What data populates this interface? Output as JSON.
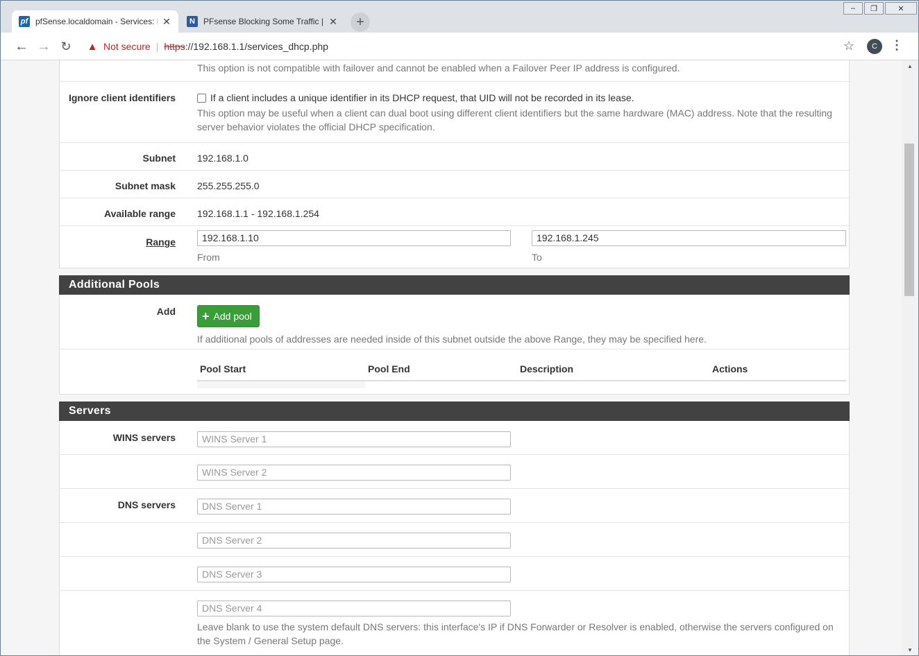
{
  "browser": {
    "tabs": [
      {
        "title": "pfSense.localdomain - Services: D",
        "active": true
      },
      {
        "title": "PFsense Blocking Some Traffic | N",
        "active": false
      }
    ],
    "new_tab": "+",
    "address": {
      "warning": "Not secure",
      "scheme": "https",
      "rest": "://192.168.1.1/services_dhcp.php"
    },
    "profile_initial": "C",
    "window_controls": {
      "minimize": "–",
      "restore": "❐",
      "close": "✕"
    }
  },
  "dhcp": {
    "failover_note": "This option is not compatible with failover and cannot be enabled when a Failover Peer IP address is configured.",
    "ignore_client": {
      "label": "Ignore client identifiers",
      "checkbox_text": "If a client includes a unique identifier in its DHCP request, that UID will not be recorded in its lease.",
      "help": "This option may be useful when a client can dual boot using different client identifiers but the same hardware (MAC) address. Note that the resulting server behavior violates the official DHCP specification."
    },
    "subnet": {
      "label": "Subnet",
      "value": "192.168.1.0"
    },
    "subnet_mask": {
      "label": "Subnet mask",
      "value": "255.255.255.0"
    },
    "available_range": {
      "label": "Available range",
      "value": "192.168.1.1 - 192.168.1.254"
    },
    "range": {
      "label": "Range",
      "from_value": "192.168.1.10",
      "from_label": "From",
      "to_value": "192.168.1.245",
      "to_label": "To"
    }
  },
  "additional_pools": {
    "header": "Additional Pools",
    "add_label": "Add",
    "add_button": "Add pool",
    "help": "If additional pools of addresses are needed inside of this subnet outside the above Range, they may be specified here.",
    "columns": [
      "Pool Start",
      "Pool End",
      "Description",
      "Actions"
    ]
  },
  "servers": {
    "header": "Servers",
    "wins_label": "WINS servers",
    "wins_placeholders": [
      "WINS Server 1",
      "WINS Server 2"
    ],
    "dns_label": "DNS servers",
    "dns_placeholders": [
      "DNS Server 1",
      "DNS Server 2",
      "DNS Server 3",
      "DNS Server 4"
    ],
    "dns_help": "Leave blank to use the system default DNS servers: this interface's IP if DNS Forwarder or Resolver is enabled, otherwise the servers configured on the System / General Setup page."
  }
}
